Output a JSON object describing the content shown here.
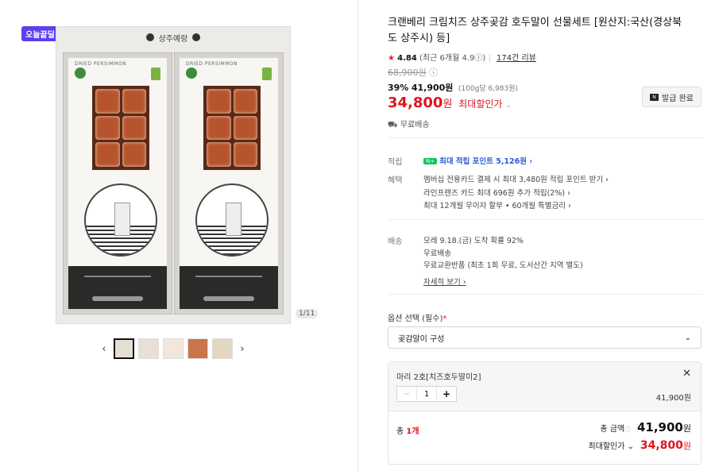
{
  "gallery": {
    "badge": "오늘끝딜",
    "hero_banner": "상주예랑",
    "box_label": "DRIED PERSIMMON",
    "counter": "1/11",
    "prev_arrow": "‹",
    "next_arrow": "›",
    "thumb_count": 5
  },
  "product": {
    "title": "크랜베리 크림치즈 상주곶감 호두말이 선물세트 [원산지:국산(경상북도 상주시) 등]",
    "rating_star": "★",
    "rating": "4.84",
    "rating_note": "(최근 6개월 4.9ⓘ)",
    "review_link": "174건 리뷰",
    "original_price": "68,900원",
    "discount_percent": "39%",
    "sale_price": "41,900원",
    "unit_price": "(100g당 6,983원)",
    "best_price_num": "34,800",
    "best_price_won": "원",
    "best_price_label": "최대할인가",
    "best_price_chev": "⌄",
    "coupon_icon": "N",
    "coupon_button": "발급 완료",
    "shipping": "무료배송"
  },
  "info": {
    "point_label": "적립",
    "point_tag": "N+",
    "point_text": "최대 적립 포인트 5,126원 ›",
    "benefit_label": "혜택",
    "benefits": [
      "멤버십 전용카드 결제 시 최대 3,480원 적립 포인트 받기 ›",
      "라인프렌즈 카드 최대 696원 추가 적립(2%) ›",
      "최대 12개월 무이자 할부 • 60개월 특별금리 ›"
    ],
    "delivery_label": "배송",
    "delivery": [
      "모레 9.18.(금) 도착 확률 92%",
      "무료배송",
      "무료교환반품 (최초 1회 무료, 도서산간 지역 별도)"
    ],
    "more_link": "자세히 보기 ›"
  },
  "options": {
    "label": "옵션 선택 (필수)",
    "required_mark": "*",
    "select_value": "곶감말이 구성",
    "select_chevron": "⌄",
    "chosen_name": "마리 2호[치즈호두말이2]",
    "close": "✕",
    "minus": "−",
    "quantity": "1",
    "plus": "+",
    "line_price": "41,900원"
  },
  "total": {
    "label": "총",
    "count": "1개",
    "amount_label": "총 금액",
    "amount_info": "ⓘ",
    "amount_value": "41,900",
    "amount_won": "원",
    "best_label": "최대할인가 ⌄",
    "best_value": "34,800",
    "best_won": "원"
  }
}
